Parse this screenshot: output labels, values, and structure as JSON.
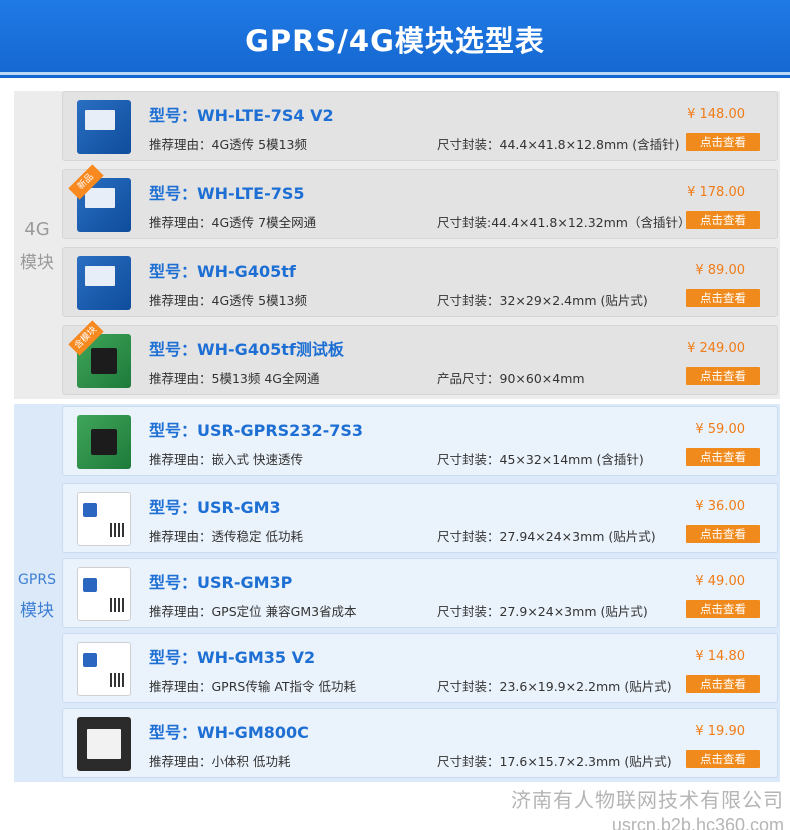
{
  "header": {
    "title": "GPRS/4G模块选型表"
  },
  "sections": {
    "g4": {
      "label_top": "4G",
      "label_bottom": "模块"
    },
    "gprs": {
      "label_top": "GPRS",
      "label_bottom": "模块"
    }
  },
  "buttons": {
    "view_label": "点击查看"
  },
  "products": [
    {
      "model": "型号：WH-LTE-7S4 V2",
      "reason": "推荐理由：4G透传 5模13频",
      "size": "尺寸封装：44.4×41.8×12.8mm (含插针)",
      "price": "¥ 148.00",
      "badge": ""
    },
    {
      "model": "型号：WH-LTE-7S5",
      "reason": "推荐理由：4G透传 7模全网通",
      "size": "尺寸封装:44.4×41.8×12.32mm（含插针）",
      "price": "¥ 178.00",
      "badge": "新品"
    },
    {
      "model": "型号：WH-G405tf",
      "reason": "推荐理由：4G透传 5模13频",
      "size": "尺寸封装：32×29×2.4mm (贴片式)",
      "price": "¥ 89.00",
      "badge": ""
    },
    {
      "model": "型号：WH-G405tf测试板",
      "reason": "推荐理由：5模13频 4G全网通",
      "size": "产品尺寸：90×60×4mm",
      "price": "¥ 249.00",
      "badge": "含模块"
    },
    {
      "model": "型号：USR-GPRS232-7S3",
      "reason": "推荐理由：嵌入式 快速透传",
      "size": "尺寸封装：45×32×14mm (含插针)",
      "price": "¥ 59.00",
      "badge": ""
    },
    {
      "model": "型号：USR-GM3",
      "reason": "推荐理由：透传稳定 低功耗",
      "size": "尺寸封装：27.94×24×3mm (贴片式)",
      "price": "¥ 36.00",
      "badge": ""
    },
    {
      "model": "型号：USR-GM3P",
      "reason": "推荐理由：GPS定位 兼容GM3省成本",
      "size": "尺寸封装：27.9×24×3mm (贴片式)",
      "price": "¥ 49.00",
      "badge": ""
    },
    {
      "model": "型号：WH-GM35 V2",
      "reason": "推荐理由：GPRS传输 AT指令 低功耗",
      "size": "尺寸封装：23.6×19.9×2.2mm (贴片式)",
      "price": "¥ 14.80",
      "badge": ""
    },
    {
      "model": "型号：WH-GM800C",
      "reason": "推荐理由：小体积 低功耗",
      "size": "尺寸封装：17.6×15.7×2.3mm (贴片式)",
      "price": "¥ 19.90",
      "badge": ""
    }
  ],
  "watermark": {
    "line1": "济南有人物联网技术有限公司",
    "line2": "usrcn.b2b.hc360.com"
  }
}
